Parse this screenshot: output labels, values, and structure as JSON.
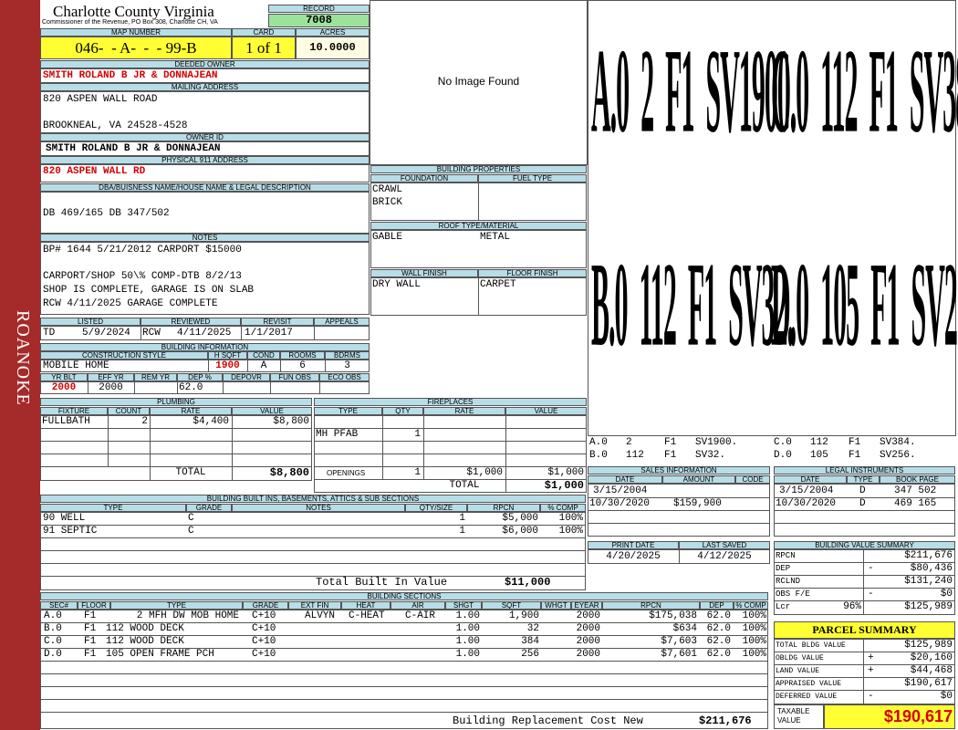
{
  "sidebar": {
    "label": "ROANOKE",
    "color": "#a52a2a"
  },
  "header": {
    "county": "Charlotte County Virginia",
    "commissioner": "Commissioner of the Revenue, PO Box 308, Charlotte CH, VA",
    "record_label": "RECORD",
    "record_value": "7008",
    "map_number_label": "MAP NUMBER",
    "map_number": "046-  - A-  -  - 99-B",
    "card_label": "CARD",
    "card": "1 of 1",
    "acres_label": "ACRES",
    "acres": "10.0000"
  },
  "owner": {
    "deeded_owner_label": "DEEDED OWNER",
    "deeded_owner": "SMITH ROLAND B JR & DONNAJEAN",
    "mailing_label": "MAILING ADDRESS",
    "mailing_line1": "820 ASPEN WALL ROAD",
    "mailing_line2": "BROOKNEAL, VA 24528-4528",
    "owner_id_label": "OWNER ID",
    "owner_id": "SMITH ROLAND B JR & DONNAJEAN",
    "physical_label": "PHYSICAL 911 ADDRESS",
    "physical": "820 ASPEN WALL RD"
  },
  "legal": {
    "label": "DBA/BUISNESS NAME/HOUSE NAME & LEGAL DESCRIPTION",
    "text": "DB 469/165 DB 347/502"
  },
  "notes": {
    "label": "NOTES",
    "line1": "BP# 1644 5/21/2012 CARPORT $15000",
    "line2": "CARPORT/SHOP 50\\% COMP-DTB 8/2/13",
    "line3": "SHOP IS COMPLETE, GARAGE IS ON SLAB",
    "line4": "RCW 4/11/2025 GARAGE COMPLETE"
  },
  "image": {
    "no_image": "No Image Found"
  },
  "listing": {
    "listed_label": "LISTED",
    "reviewed_label": "REVIEWED",
    "revisit_label": "REVISIT",
    "appeals_label": "APPEALS",
    "listed_by": "TD",
    "listed_date": "5/9/2024",
    "reviewed_by": "RCW",
    "reviewed_date": "4/11/2025",
    "revisit": "1/1/2017"
  },
  "building_info": {
    "label": "BUILDING INFORMATION",
    "style_label": "CONSTRUCTION STYLE",
    "hsqft_label": "H SQFT",
    "cond_label": "COND",
    "rooms_label": "ROOMS",
    "bdrms_label": "BDRMS",
    "style": "MOBILE HOME",
    "hsqft": "1900",
    "cond": "A",
    "rooms": "6",
    "bdrms": "3",
    "yrblt_label": "YR BLT",
    "effyr_label": "EFF YR",
    "remyr_label": "REM YR",
    "dep_label": "DEP %",
    "depovr_label": "DEPOVR",
    "funobs_label": "FUN OBS",
    "ecoobs_label": "ECO OBS",
    "yrblt": "2000",
    "effyr": "2000",
    "dep": "62.0"
  },
  "building_props": {
    "label": "BUILDING PROPERTIES",
    "foundation_label": "FOUNDATION",
    "fuel_label": "FUEL TYPE",
    "foundation1": "CRAWL",
    "foundation2": "BRICK",
    "roof_label": "ROOF TYPE/MATERIAL",
    "roof_type": "GABLE",
    "roof_material": "METAL",
    "wall_label": "WALL FINISH",
    "floor_label": "FLOOR FINISH",
    "wall": "DRY WALL",
    "floor": "CARPET"
  },
  "sketch": {
    "top_left": "A.0  2  F1  SV1900.",
    "top_right": "C.0  112  F1  SV384.",
    "bottom_left": "B.0  112  F1  SV32.",
    "bottom_right": "D.0  105  F1  SV256.",
    "key1a": "A.0",
    "key1b": "2",
    "key1c": "F1",
    "key1d": "SV1900.",
    "key1e": "C.0",
    "key1f": "112",
    "key1g": "F1",
    "key1h": "SV384.",
    "key2a": "B.0",
    "key2b": "112",
    "key2c": "F1",
    "key2d": "SV32.",
    "key2e": "D.0",
    "key2f": "105",
    "key2g": "F1",
    "key2h": "SV256."
  },
  "plumbing": {
    "label": "PLUMBING",
    "fixture_label": "FIXTURE",
    "count_label": "COUNT",
    "rate_label": "RATE",
    "value_label": "VALUE",
    "fixture": "FULLBATH",
    "count": "2",
    "rate": "$4,400",
    "value": "$8,800",
    "total_label": "TOTAL",
    "total": "$8,800"
  },
  "fireplaces": {
    "label": "FIREPLACES",
    "type_label": "TYPE",
    "qty_label": "QTY",
    "rate_label": "RATE",
    "value_label": "VALUE",
    "type": "MH PFAB",
    "qty": "1",
    "openings_label": "OPENINGS",
    "openings_qty": "1",
    "openings_rate": "$1,000",
    "openings_value": "$1,000",
    "total_label": "TOTAL",
    "total": "$1,000"
  },
  "sales": {
    "label": "SALES INFORMATION",
    "date_label": "DATE",
    "amount_label": "AMOUNT",
    "code_label": "CODE",
    "rows": [
      {
        "date": "3/15/2004",
        "amount": "",
        "code": ""
      },
      {
        "date": "10/30/2020",
        "amount": "$159,900",
        "code": ""
      }
    ]
  },
  "legal_instruments": {
    "label": "LEGAL INSTRUMENTS",
    "date_label": "DATE",
    "type_label": "TYPE",
    "book_label": "BOOK PAGE",
    "rows": [
      {
        "date": "3/15/2004",
        "type": "D",
        "book": "347 502"
      },
      {
        "date": "10/30/2020",
        "type": "D",
        "book": "469 165"
      }
    ]
  },
  "built_ins": {
    "label": "BUILDING BUILT INS, BASEMENTS, ATTICS & SUB SECTIONS",
    "type_label": "TYPE",
    "grade_label": "GRADE",
    "notes_label": "NOTES",
    "qty_label": "QTY/SIZE",
    "rpcn_label": "RPCN",
    "comp_label": "% COMP",
    "rows": [
      {
        "type": "90 WELL",
        "grade": "C",
        "qty": "1",
        "rpcn": "$5,000",
        "comp": "100%"
      },
      {
        "type": "91 SEPTIC",
        "grade": "C",
        "qty": "1",
        "rpcn": "$6,000",
        "comp": "100%"
      }
    ],
    "total_label": "Total Built In Value",
    "total": "$11,000"
  },
  "print": {
    "print_date_label": "PRINT DATE",
    "last_saved_label": "LAST SAVED",
    "print_date": "4/20/2025",
    "last_saved": "4/12/2025"
  },
  "value_summary": {
    "label": "BUILDING VALUE SUMMARY",
    "rows": [
      {
        "label": "RPCN",
        "sign": "",
        "value": "$211,676"
      },
      {
        "label": "DEP",
        "sign": "-",
        "value": "$80,436"
      },
      {
        "label": "RCLND",
        "sign": "",
        "value": "$131,240"
      },
      {
        "label": "OBS F/E",
        "sign": "-",
        "value": "$0"
      },
      {
        "label": "Lcr",
        "pct": "96%",
        "sign": "",
        "value": "$125,989"
      }
    ]
  },
  "parcel_summary": {
    "label": "PARCEL SUMMARY",
    "rows": [
      {
        "label": "TOTAL BLDG VALUE",
        "sign": "",
        "value": "$125,989"
      },
      {
        "label": "OBLDG VALUE",
        "sign": "+",
        "value": "$20,160"
      },
      {
        "label": "LAND VALUE",
        "sign": "+",
        "value": "$44,468"
      },
      {
        "label": "APPRAISED VALUE",
        "sign": "",
        "value": "$190,617"
      },
      {
        "label": "DEFERRED VALUE",
        "sign": "-",
        "value": "$0"
      }
    ],
    "taxable_label": "TAXABLE VALUE",
    "taxable": "$190,617"
  },
  "sections": {
    "label": "BUILDING SECTIONS",
    "headers": [
      "SEC#",
      "FLOOR",
      "TYPE",
      "GRADE",
      "EXT FIN",
      "HEAT",
      "AIR",
      "SHGT",
      "SQFT",
      "WHGT",
      "EYEAR",
      "RPCN",
      "DEP",
      "% COMP"
    ],
    "rows": [
      {
        "sec": "A.0",
        "floor": "F1",
        "type": "2 MFH DW MOB HOME",
        "grade": "C+10",
        "ext": "ALVYN",
        "heat": "C-HEAT",
        "air": "C-AIR",
        "shgt": "1.00",
        "sqft": "1,900",
        "eyear": "2000",
        "rpcn": "$175,038",
        "dep": "62.0",
        "comp": "100%"
      },
      {
        "sec": "B.0",
        "floor": "F1",
        "type": "112 WOOD DECK",
        "grade": "C+10",
        "ext": "",
        "heat": "",
        "air": "",
        "shgt": "1.00",
        "sqft": "32",
        "eyear": "2000",
        "rpcn": "$634",
        "dep": "62.0",
        "comp": "100%"
      },
      {
        "sec": "C.0",
        "floor": "F1",
        "type": "112 WOOD DECK",
        "grade": "C+10",
        "ext": "",
        "heat": "",
        "air": "",
        "shgt": "1.00",
        "sqft": "384",
        "eyear": "2000",
        "rpcn": "$7,603",
        "dep": "62.0",
        "comp": "100%"
      },
      {
        "sec": "D.0",
        "floor": "F1",
        "type": "105 OPEN FRAME PCH",
        "grade": "C+10",
        "ext": "",
        "heat": "",
        "air": "",
        "shgt": "1.00",
        "sqft": "256",
        "eyear": "2000",
        "rpcn": "$7,601",
        "dep": "62.0",
        "comp": "100%"
      }
    ],
    "total_label": "Building Replacement Cost New",
    "total": "$211,676"
  }
}
